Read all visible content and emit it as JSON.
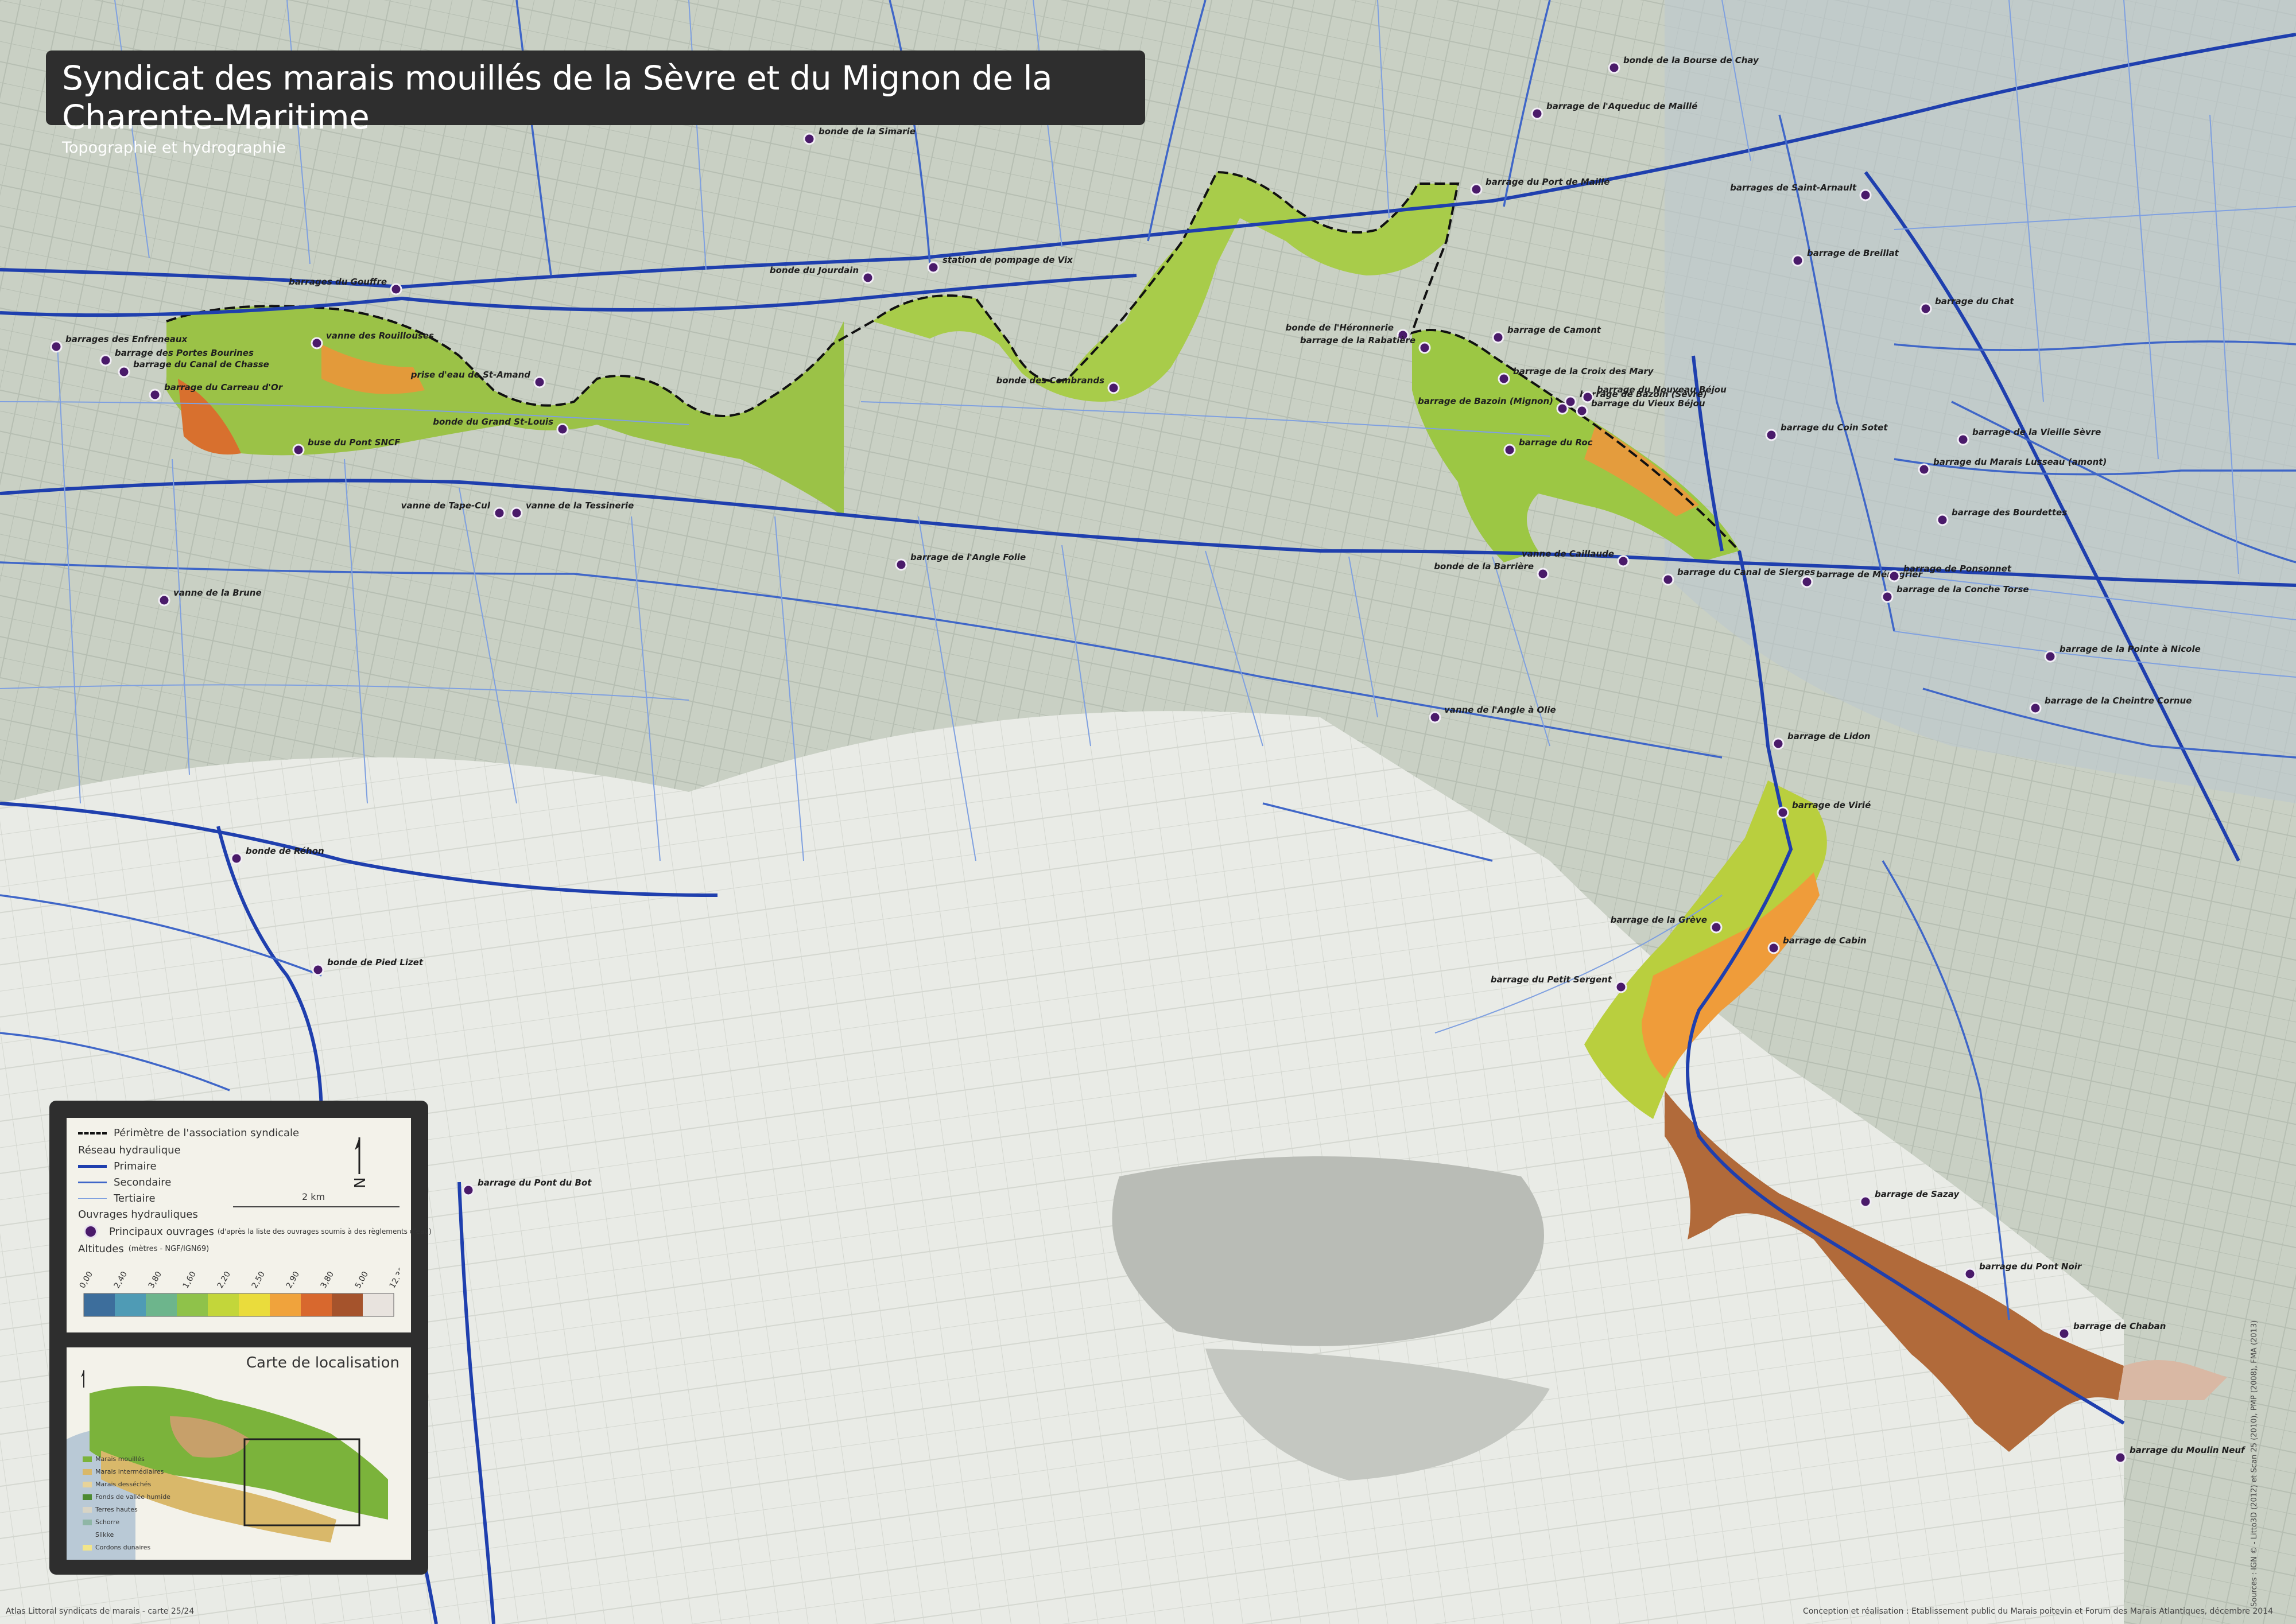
{
  "title": "Syndicat des marais mouillés de la Sèvre et du Mignon de la Charente-Maritime",
  "subtitle": "Topographie et hydrographie",
  "colors": {
    "primary_network": "#1f3fae",
    "secondary_network": "#3f66c8",
    "tertiary_network": "#7fa0e0",
    "structure_marker": "#4a1a6a",
    "perimeter": "#111111",
    "base_map": "#d9ddd6"
  },
  "legend": {
    "perimeter_label": "Périmètre de l'association syndicale",
    "network_heading": "Réseau hydraulique",
    "network_items": [
      "Primaire",
      "Secondaire",
      "Tertiaire"
    ],
    "structures_heading": "Ouvrages hydrauliques",
    "structures_item": "Principaux ouvrages",
    "structures_note": "(d'après la liste des ouvrages soumis à des règlements d'eau)",
    "altitude_heading": "Altitudes",
    "altitude_units": "(mètres - NGF/IGN69)",
    "altitude_ticks": [
      "0,00",
      "2,40",
      "3,80",
      "1,60",
      "2,20",
      "2,50",
      "2,90",
      "3,80",
      "5,00",
      "12,30"
    ],
    "altitude_colors": [
      "#3d6e9c",
      "#4f9bb5",
      "#6db58c",
      "#8fc24a",
      "#c3d63a",
      "#eadc3c",
      "#f0a33c",
      "#d8682e",
      "#a5532c",
      "#e8e3de"
    ],
    "scale_label": "2 km",
    "north_icon": "north-arrow-icon"
  },
  "location_map": {
    "title": "Carte de localisation",
    "items": [
      {
        "label": "Marais mouillés",
        "color": "#7bb33b"
      },
      {
        "label": "Marais intermédiaires",
        "color": "#d9b86a"
      },
      {
        "label": "Marais desséchés",
        "color": "#e7d39a"
      },
      {
        "label": "Fonds de vallée humide",
        "color": "#4d8a32"
      },
      {
        "label": "Terres hautes",
        "color": "#d8d4c5"
      },
      {
        "label": "Schorre",
        "color": "#8fb6a6"
      },
      {
        "label": "Slikke",
        "color": "#b9c9d6"
      },
      {
        "label": "Cordons dunaires",
        "color": "#f2e58a"
      }
    ]
  },
  "structures": [
    {
      "name": "bonde de la Bourse de Chay"
    },
    {
      "name": "barrage de l'Aqueduc de Maillé"
    },
    {
      "name": "bonde de la Simarie"
    },
    {
      "name": "barrage du Port de Maillé"
    },
    {
      "name": "barrages de Saint-Arnault"
    },
    {
      "name": "barrage de Breillat"
    },
    {
      "name": "barrage du Chat"
    },
    {
      "name": "barrages du Gouffre"
    },
    {
      "name": "bonde du Jourdain"
    },
    {
      "name": "station de pompage de Vix"
    },
    {
      "name": "barrages des Enfreneaux"
    },
    {
      "name": "barrage des Portes Bourines"
    },
    {
      "name": "vanne des Rouillouses"
    },
    {
      "name": "barrage du Canal de Chasse"
    },
    {
      "name": "barrage du Carreau d'Or"
    },
    {
      "name": "prise d'eau de St-Amand"
    },
    {
      "name": "bonde du Grand St-Louis"
    },
    {
      "name": "buse du Pont SNCF"
    },
    {
      "name": "vanne de Tape-Cul"
    },
    {
      "name": "vanne de la Tessinerie"
    },
    {
      "name": "bonde des Combrands"
    },
    {
      "name": "bonde de l'Héronnerie"
    },
    {
      "name": "barrage de la Rabatière"
    },
    {
      "name": "barrage de Camont"
    },
    {
      "name": "barrage de la Croix des Mary"
    },
    {
      "name": "barrage de Bazoin (Sèvre)"
    },
    {
      "name": "barrage du Nouveau Béjou"
    },
    {
      "name": "barrage du Vieux Béjou"
    },
    {
      "name": "barrage de Bazoin (Mignon)"
    },
    {
      "name": "barrage du Roc"
    },
    {
      "name": "barrage du Coin Sotet"
    },
    {
      "name": "barrage de la Vieille Sèvre"
    },
    {
      "name": "barrage du Marais Lusseau (amont)"
    },
    {
      "name": "barrage des Bourdettes"
    },
    {
      "name": "barrage de l'Angle Folie"
    },
    {
      "name": "vanne de Caillaude"
    },
    {
      "name": "bonde de la Barrière"
    },
    {
      "name": "barrage du Canal de Sierges"
    },
    {
      "name": "barrage de Ménegrier"
    },
    {
      "name": "barrage de Ponsonnet"
    },
    {
      "name": "barrage de la Conche Torse"
    },
    {
      "name": "vanne de la Brune"
    },
    {
      "name": "barrage de la Pointe à Nicole"
    },
    {
      "name": "barrage de la Cheintre Cornue"
    },
    {
      "name": "vanne de l'Angle à Olie"
    },
    {
      "name": "barrage de Lidon"
    },
    {
      "name": "barrage de Virié"
    },
    {
      "name": "bonde de Réhon"
    },
    {
      "name": "barrage de la Grève"
    },
    {
      "name": "barrage de Cabin"
    },
    {
      "name": "barrage du Petit Sergent"
    },
    {
      "name": "bonde de Pied Lizet"
    },
    {
      "name": "barrage du Pont du Bot"
    },
    {
      "name": "barrage de Sazay"
    },
    {
      "name": "barrage du Pont Noir"
    },
    {
      "name": "barrage de Chaban"
    },
    {
      "name": "barrage du Moulin Neuf"
    }
  ],
  "footer_left": "Atlas Littoral syndicats de marais - carte 25/24",
  "footer_right": "Conception et réalisation : Etablissement public du Marais poitevin et Forum des Marais Atlantiques, décembre 2014",
  "sources": "Sources : IGN © - Litto3D (2012) et Scan 25 (2010), PMP (2008), FMA (2013)"
}
